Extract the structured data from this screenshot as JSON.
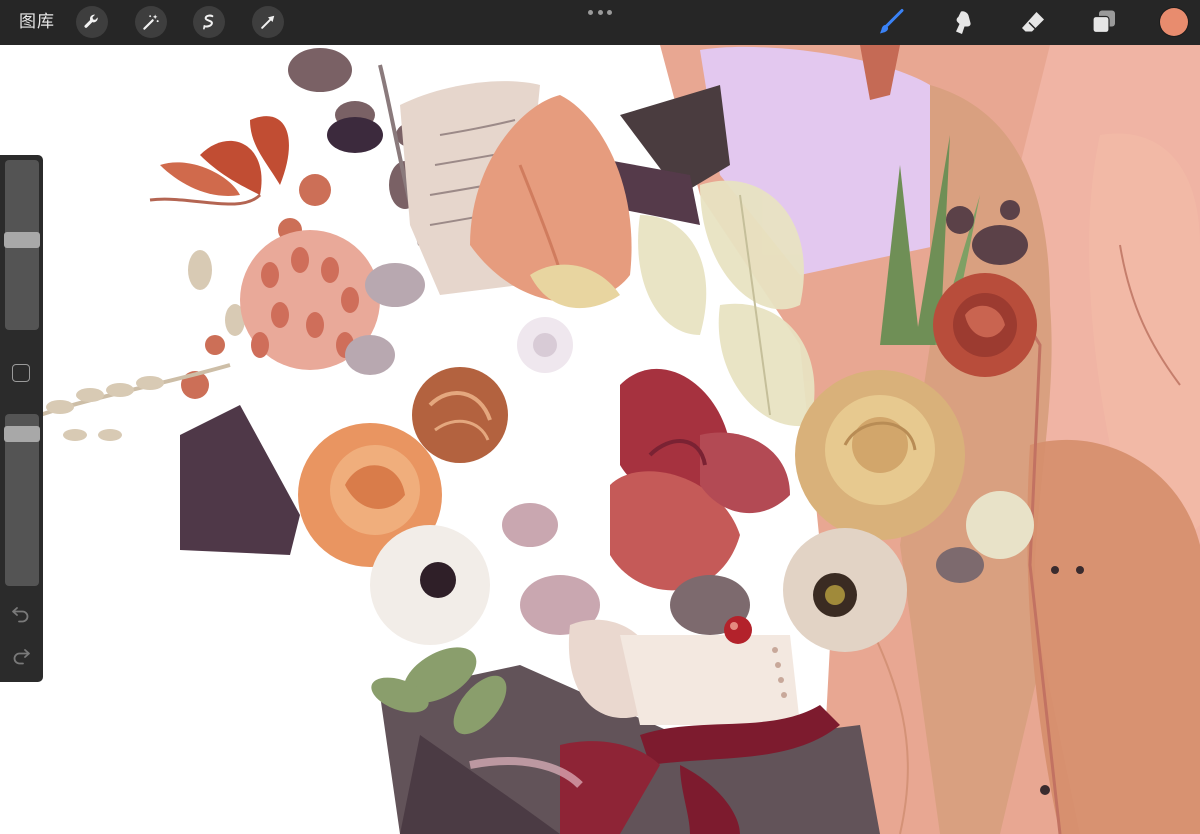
{
  "toolbar": {
    "gallery_label": "图库",
    "left_tools": [
      "wrench-icon",
      "magic-wand-icon",
      "selection-icon",
      "transform-arrow-icon"
    ],
    "right_tools": [
      "brush-icon",
      "smudge-icon",
      "eraser-icon",
      "layers-icon"
    ],
    "active_tool": "brush-icon",
    "current_color": "#e88c6e"
  },
  "sidebar": {
    "brush_size_level": 0.47,
    "opacity_level": 0.08
  },
  "colors": {
    "toolbar_bg": "#262626",
    "active_accent": "#3a82f6"
  }
}
